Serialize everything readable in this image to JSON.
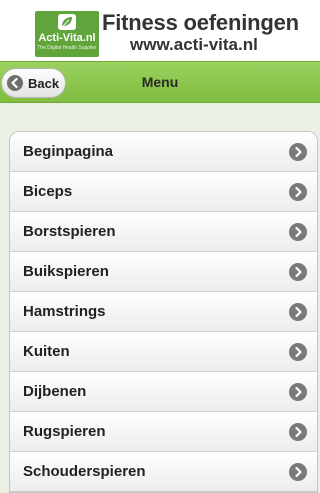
{
  "banner": {
    "logo_text": "Acti-Vita.nl",
    "logo_tagline": "The Digital Health Supplier",
    "logo_icon": "leaf-icon",
    "title": "Fitness oefeningen",
    "url": "www.acti-vita.nl"
  },
  "header": {
    "back_label": "Back",
    "back_icon": "chevron-left-icon",
    "title": "Menu"
  },
  "menu": {
    "items": [
      {
        "label": "Beginpagina"
      },
      {
        "label": "Biceps"
      },
      {
        "label": "Borstspieren"
      },
      {
        "label": "Buikspieren"
      },
      {
        "label": "Hamstrings"
      },
      {
        "label": "Kuiten"
      },
      {
        "label": "Dijbenen"
      },
      {
        "label": "Rugspieren"
      },
      {
        "label": "Schouderspieren"
      }
    ],
    "arrow_icon": "chevron-right-icon"
  },
  "colors": {
    "brand_green": "#5fa53b",
    "header_green": "#8cc84f",
    "page_background": "#eaf1e4"
  }
}
